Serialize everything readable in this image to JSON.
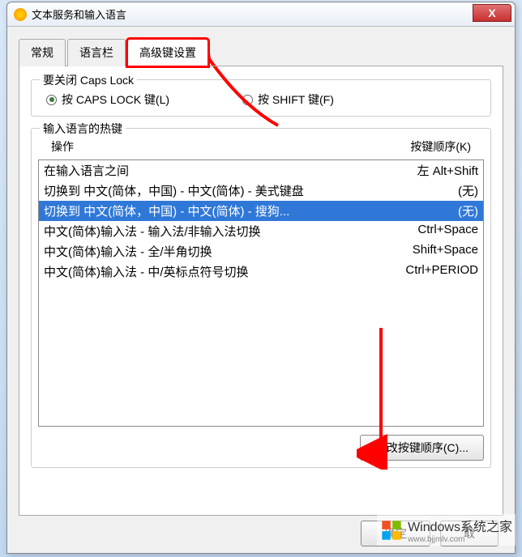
{
  "dialog": {
    "title": "文本服务和输入语言",
    "close": "X"
  },
  "tabs": {
    "tab1": "常规",
    "tab2": "语言栏",
    "tab3": "高级键设置"
  },
  "capslock_group": {
    "title": "要关闭 Caps Lock",
    "opt1": "按 CAPS LOCK 键(L)",
    "opt2": "按 SHIFT 键(F)"
  },
  "hotkey_group": {
    "title": "输入语言的热键",
    "col1": "操作",
    "col2": "按键顺序(K)",
    "rows": [
      {
        "action": "在输入语言之间",
        "key": "左 Alt+Shift"
      },
      {
        "action": "切换到 中文(简体，中国) - 中文(简体) - 美式键盘",
        "key": "(无)"
      },
      {
        "action": "切换到 中文(简体，中国) - 中文(简体) - 搜狗...",
        "key": "(无)"
      },
      {
        "action": "中文(简体)输入法 - 输入法/非输入法切换",
        "key": "Ctrl+Space"
      },
      {
        "action": "中文(简体)输入法 - 全/半角切换",
        "key": "Shift+Space"
      },
      {
        "action": "中文(简体)输入法 - 中/英标点符号切换",
        "key": "Ctrl+PERIOD"
      }
    ],
    "change_btn": "更改按键顺序(C)..."
  },
  "footer": {
    "ok": "确定",
    "cancel": "取"
  },
  "watermark": {
    "main": "Windows系统之家",
    "sub": "www.bjjmlv.com"
  }
}
